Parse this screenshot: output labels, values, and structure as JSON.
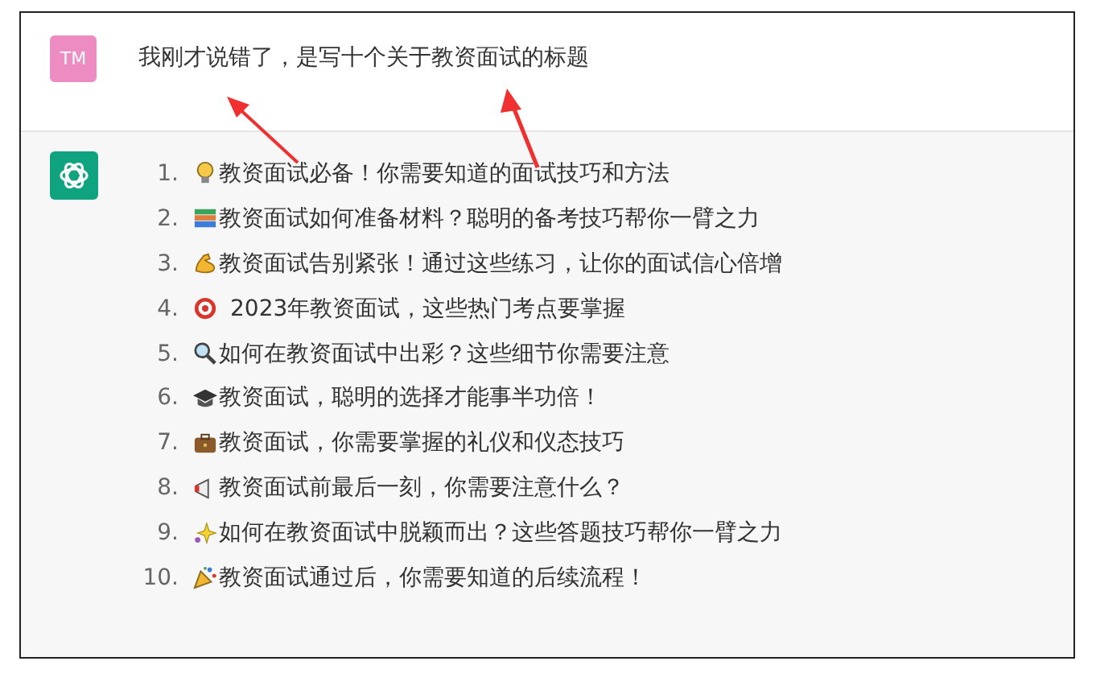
{
  "user_message": {
    "avatar": "TM",
    "text": "我刚才说错了，是写十个关于教资面试的标题"
  },
  "assistant_message": {
    "items": [
      {
        "number": "1.",
        "text": "教资面试必备！你需要知道的面试技巧和方法"
      },
      {
        "number": "2.",
        "text": "教资面试如何准备材料？聪明的备考技巧帮你一臂之力"
      },
      {
        "number": "3.",
        "text": "教资面试告别紧张！通过这些练习，让你的面试信心倍增"
      },
      {
        "number": "4.",
        "text": "2023年教资面试，这些热门考点要掌握"
      },
      {
        "number": "5.",
        "text": "如何在教资面试中出彩？这些细节你需要注意"
      },
      {
        "number": "6.",
        "text": "教资面试，聪明的选择才能事半功倍！"
      },
      {
        "number": "7.",
        "text": "教资面试，你需要掌握的礼仪和仪态技巧"
      },
      {
        "number": "8.",
        "text": "教资面试前最后一刻，你需要注意什么？"
      },
      {
        "number": "9.",
        "text": "如何在教资面试中脱颖而出？这些答题技巧帮你一臂之力"
      },
      {
        "number": "10.",
        "text": "教资面试通过后，你需要知道的后续流程！"
      }
    ]
  }
}
